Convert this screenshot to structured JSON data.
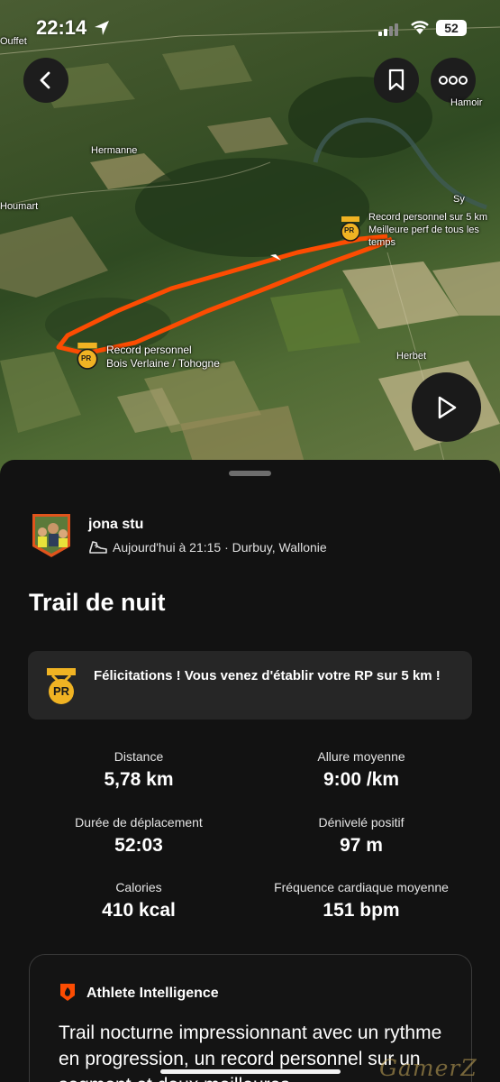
{
  "status_bar": {
    "time": "22:14",
    "battery": "52"
  },
  "map": {
    "places": [
      "Ouffet",
      "Hermanne",
      "Houmart",
      "Sy",
      "Herbet",
      "Hamoir"
    ],
    "pr_markers": [
      {
        "badge": "PR",
        "line1": "Record personnel sur 5 km",
        "line2": "Meilleure perf de tous les",
        "line3": "temps"
      },
      {
        "badge": "PR",
        "line1": "Record personnel",
        "line2": "Bois Verlaine / Tohogne"
      }
    ]
  },
  "athlete": {
    "name": "jona stu",
    "meta": "Aujourd'hui à 21:15 · Durbuy, Wallonie"
  },
  "activity": {
    "title": "Trail de nuit"
  },
  "pr_banner": {
    "badge": "PR",
    "message": "Félicitations ! Vous venez d'établir votre RP sur 5 km !"
  },
  "stats": [
    {
      "label": "Distance",
      "value": "5,78 km"
    },
    {
      "label": "Allure moyenne",
      "value": "9:00 /km"
    },
    {
      "label": "Durée de déplacement",
      "value": "52:03"
    },
    {
      "label": "Dénivelé positif",
      "value": "97 m"
    },
    {
      "label": "Calories",
      "value": "410 kcal"
    },
    {
      "label": "Fréquence cardiaque moyenne",
      "value": "151 bpm"
    }
  ],
  "athlete_intelligence": {
    "title": "Athlete Intelligence",
    "text": "Trail nocturne impressionnant avec un rythme en progression, un record personnel sur un segment et deux meilleures"
  },
  "watermark": "GamerZ",
  "colors": {
    "route": "#fc4c02",
    "pr_gold": "#f0b323",
    "sheet_bg": "#121212",
    "card_bg": "#262626"
  }
}
